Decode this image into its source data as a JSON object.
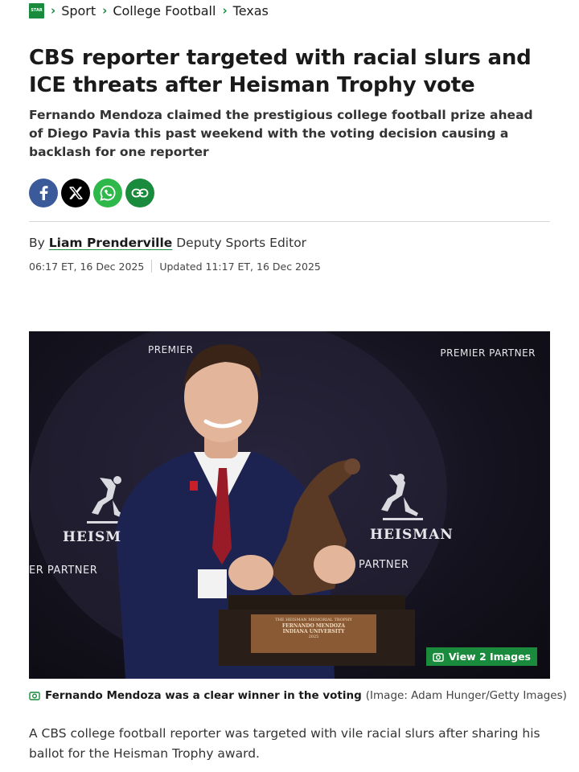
{
  "breadcrumb": {
    "logo_text": "STAR",
    "items": [
      "Sport",
      "College Football",
      "Texas"
    ]
  },
  "article": {
    "headline": "CBS reporter targeted with racial slurs and ICE threats after Heisman Trophy vote",
    "standfirst": "Fernando Mendoza claimed the prestigious college football prize ahead of Diego Pavia this past weekend with the voting decision causing a backlash for one reporter",
    "byline_prefix": "By",
    "author": "Liam Prenderville",
    "author_role": "Deputy Sports Editor",
    "published": "06:17 ET, 16 Dec 2025",
    "updated": "Updated 11:17 ET, 16 Dec 2025",
    "body_first_paragraph": "A CBS college football reporter was targeted with vile racial slurs after sharing his ballot for the Heisman Trophy award."
  },
  "share": {
    "icons": [
      "facebook-icon",
      "x-icon",
      "whatsapp-icon",
      "link-icon"
    ]
  },
  "hero": {
    "overlay_texts": {
      "premier_top_left": "PREMIER",
      "premier_top_right": "PREMIER PARTNER",
      "partner_left": "ER PARTNER",
      "partner_right": "PARTNER",
      "heisman_left": "HEISM",
      "heisman_right": "HEISMAN",
      "plaque_line1": "THE HEISMAN MEMORIAL TROPHY",
      "plaque_line2": "FERNANDO MENDOZA",
      "plaque_line3": "INDIANA UNIVERSITY",
      "plaque_year": "2025"
    },
    "view_images_label": "View 2 Images",
    "caption": "Fernando Mendoza was a clear winner in the voting",
    "credit": "(Image: Adam Hunger/Getty Images)"
  },
  "colors": {
    "brand_green": "#1a8a3c",
    "facebook_blue": "#3a5a9a",
    "whatsapp_green": "#2fb84a"
  }
}
